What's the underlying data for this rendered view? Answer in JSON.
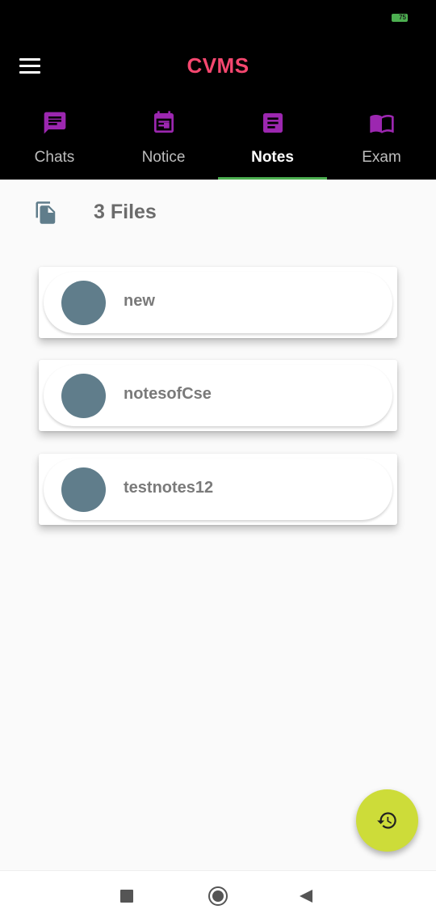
{
  "status_bar": {
    "battery_level": "75"
  },
  "app_bar": {
    "title": "CVMS",
    "menu_icon": "hamburger-menu-icon"
  },
  "tabs": [
    {
      "label": "Chats",
      "icon": "chat-icon",
      "active": false
    },
    {
      "label": "Notice",
      "icon": "calendar-icon",
      "active": false
    },
    {
      "label": "Notes",
      "icon": "notes-icon",
      "active": true
    },
    {
      "label": "Exam",
      "icon": "book-icon",
      "active": false
    }
  ],
  "files": {
    "count_label": "3 Files",
    "icon": "files-copy-icon",
    "items": [
      {
        "name": "new"
      },
      {
        "name": "notesofCse"
      },
      {
        "name": "testnotes12"
      }
    ]
  },
  "fab": {
    "icon": "refresh-history-icon"
  },
  "colors": {
    "title": "#f5476f",
    "tab_icon": "#9c27b0",
    "tab_indicator": "#4caf50",
    "avatar": "#607d8b",
    "fab": "#cddc39"
  },
  "nav_bar": {
    "icons": [
      "recent-apps-icon",
      "home-icon",
      "back-icon"
    ]
  }
}
